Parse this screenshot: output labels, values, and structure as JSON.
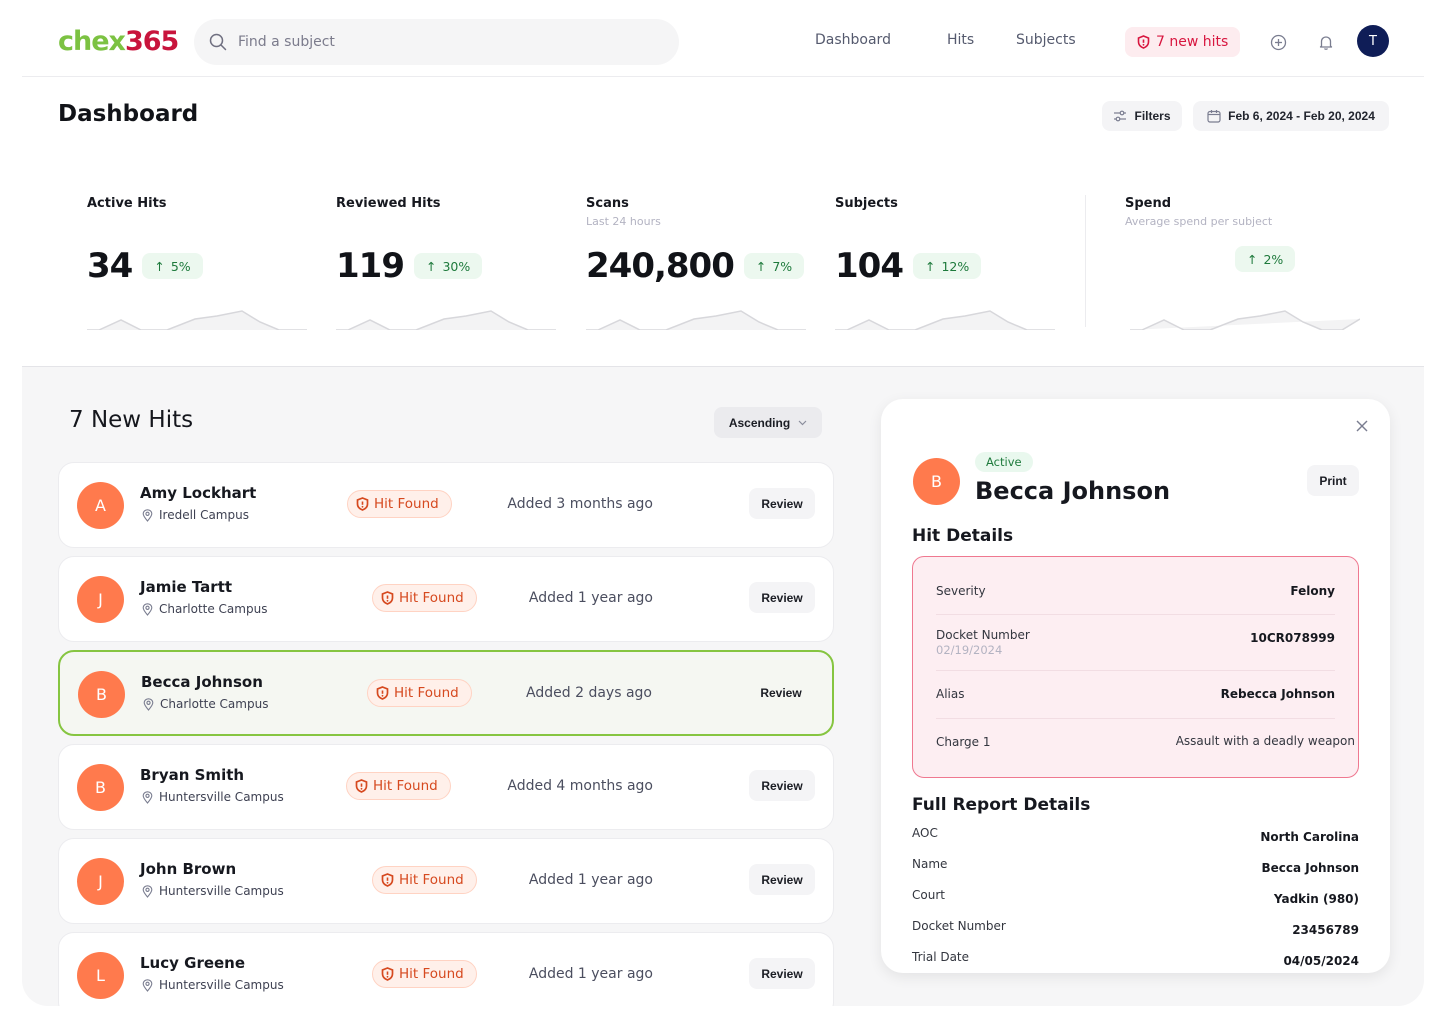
{
  "header": {
    "logo_part1": "chex",
    "logo_part2": "365",
    "search_placeholder": "Find a subject",
    "nav": [
      "Dashboard",
      "Hits",
      "Subjects"
    ],
    "new_hits_label": "7 new hits",
    "user_initial": "T"
  },
  "dashboard": {
    "title": "Dashboard",
    "filters_label": "Filters",
    "date_range": "Feb 6, 2024 - Feb 20, 2024"
  },
  "stats": [
    {
      "label": "Active Hits",
      "sublabel": "",
      "value": "34",
      "delta": "5%",
      "trend": "up"
    },
    {
      "label": "Reviewed Hits",
      "sublabel": "",
      "value": "119",
      "delta": "30%",
      "trend": "up"
    },
    {
      "label": "Scans",
      "sublabel": "Last 24 hours",
      "value": "240,800",
      "delta": "7%",
      "trend": "up"
    },
    {
      "label": "Subjects",
      "sublabel": "",
      "value": "104",
      "delta": "12%",
      "trend": "up"
    },
    {
      "label": "Spend",
      "sublabel": "Average spend per subject",
      "value": "",
      "delta": "2%",
      "trend": "up"
    }
  ],
  "hits": {
    "title": "7 New Hits",
    "sort_label": "Ascending",
    "review_label": "Review",
    "badge_label": "Hit Found",
    "items": [
      {
        "initial": "A",
        "name": "Amy Lockhart",
        "campus": "Iredell Campus",
        "added": "Added 3 months ago",
        "selected": false
      },
      {
        "initial": "J",
        "name": "Jamie Tartt",
        "campus": "Charlotte Campus",
        "added": "Added 1 year ago",
        "selected": false
      },
      {
        "initial": "B",
        "name": "Becca Johnson",
        "campus": "Charlotte Campus",
        "added": "Added 2 days ago",
        "selected": true
      },
      {
        "initial": "B",
        "name": "Bryan Smith",
        "campus": "Huntersville Campus",
        "added": "Added 4 months ago",
        "selected": false
      },
      {
        "initial": "J",
        "name": "John Brown",
        "campus": "Huntersville Campus",
        "added": "Added 1 year ago",
        "selected": false
      },
      {
        "initial": "L",
        "name": "Lucy Greene",
        "campus": "Huntersville Campus",
        "added": "Added 1 year ago",
        "selected": false
      }
    ]
  },
  "detail": {
    "initial": "B",
    "status": "Active",
    "name": "Becca Johnson",
    "print_label": "Print",
    "hit_details_title": "Hit Details",
    "hit_details": [
      {
        "label": "Severity",
        "sublabel": "",
        "value": "Felony"
      },
      {
        "label": "Docket Number",
        "sublabel": "02/19/2024",
        "value": "10CR078999"
      },
      {
        "label": "Alias",
        "sublabel": "",
        "value": "Rebecca Johnson"
      },
      {
        "label": "Charge 1",
        "sublabel": "",
        "value": "Assault with a deadly weapon"
      }
    ],
    "full_report_title": "Full Report Details",
    "full_report": [
      {
        "label": "AOC",
        "value": "North Carolina"
      },
      {
        "label": "Name",
        "value": "Becca Johnson"
      },
      {
        "label": "Court",
        "value": "Yadkin (980)"
      },
      {
        "label": "Docket Number",
        "value": "23456789"
      },
      {
        "label": "Trial Date",
        "value": "04/05/2024"
      }
    ]
  },
  "colors": {
    "brand_green": "#7cc242",
    "brand_red": "#c8143c",
    "avatar_orange": "#ff7a4d",
    "positive_green": "#1e7a3c",
    "selected_border": "#86c541",
    "alert_pink": "#ef7890"
  }
}
